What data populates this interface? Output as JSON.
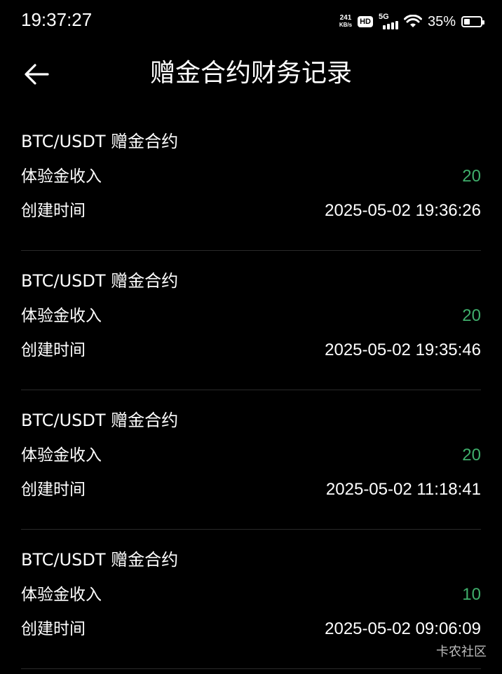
{
  "status_bar": {
    "time": "19:37:27",
    "net_speed_value": "241",
    "net_speed_unit": "KB/s",
    "hd_label": "HD",
    "network_label": "5G",
    "battery_percent_text": "35%",
    "battery_level": 0.35
  },
  "header": {
    "title": "赠金合约财务记录",
    "back_icon": "arrow-left-icon"
  },
  "colors": {
    "background": "#000000",
    "income_green": "#3fae6b",
    "divider": "#2a2a2a"
  },
  "records": [
    {
      "title": "BTC/USDT 赠金合约",
      "income_label": "体验金收入",
      "income_value": "20",
      "time_label": "创建时间",
      "time_value": "2025-05-02 19:36:26"
    },
    {
      "title": "BTC/USDT 赠金合约",
      "income_label": "体验金收入",
      "income_value": "20",
      "time_label": "创建时间",
      "time_value": "2025-05-02 19:35:46"
    },
    {
      "title": "BTC/USDT 赠金合约",
      "income_label": "体验金收入",
      "income_value": "20",
      "time_label": "创建时间",
      "time_value": "2025-05-02 11:18:41"
    },
    {
      "title": "BTC/USDT 赠金合约",
      "income_label": "体验金收入",
      "income_value": "10",
      "time_label": "创建时间",
      "time_value": "2025-05-02 09:06:09"
    }
  ],
  "watermark": "卡农社区"
}
